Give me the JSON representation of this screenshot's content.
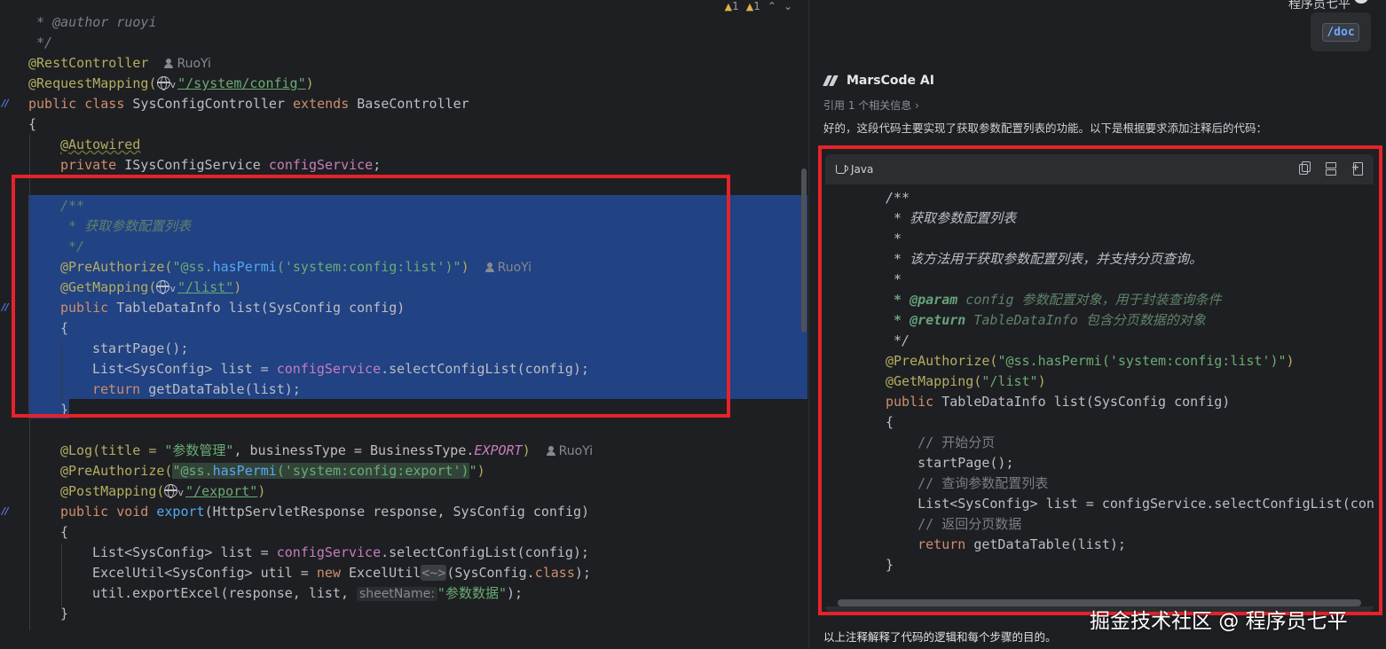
{
  "editor": {
    "inspections": {
      "warning_count": "1",
      "weak_warning_count": "1",
      "up_arrow": "⌃",
      "down_arrow": "⌄"
    },
    "author_hint": "RuoYi",
    "lines": {
      "l0": " * @author ruoyi",
      "l1": " */",
      "restcontroller": "@RestController",
      "requestmapping_pre": "@RequestMapping(",
      "requestmapping_url": "\"/system/config\"",
      "requestmapping_post": ")",
      "class_decl_kw1": "public class ",
      "class_name": "SysConfigController ",
      "class_kw2": "extends ",
      "class_base": "BaseController",
      "brace_open": "{",
      "autowired": "@Autowired",
      "field_kw": "private ",
      "field_type": "ISysConfigService ",
      "field_name": "configService",
      "field_end": ";",
      "doc_open": "/**",
      "doc_text": " * 获取参数配置列表",
      "doc_close": " */",
      "preauth_pre": "@PreAuthorize(",
      "preauth_str_a": "\"@ss.",
      "preauth_mth": "hasPermi",
      "preauth_str_list": "('system:config:list')\"",
      "preauth_post": ")",
      "getmapping_pre": "@GetMapping(",
      "getmapping_url": "\"/list\"",
      "getmapping_post": ")",
      "list_kw": "public ",
      "list_sig": "TableDataInfo list(SysConfig config)",
      "inner_brace_open": "{",
      "startpage": "startPage();",
      "list_decl_pre": "List<SysConfig> list = ",
      "list_decl_field": "configService",
      "list_decl_post": ".selectConfigList(config);",
      "return_kw": "return ",
      "return_rest": "getDataTable(list);",
      "inner_brace_close": "}",
      "log_pre": "@Log(title = ",
      "log_title": "\"参数管理\"",
      "log_mid": ", businessType = BusinessType.",
      "log_export": "EXPORT",
      "log_post": ")",
      "preauth2_str_export": "('system:config:export')",
      "preauth2_end": "\"",
      "postmapping_pre": "@PostMapping(",
      "postmapping_url": "\"/export\"",
      "export_kw": "public void ",
      "export_name": "export",
      "export_rest": "(HttpServletResponse response, SysConfig config)",
      "excel_pre": "ExcelUtil<SysConfig> util = ",
      "excel_new": "new ",
      "excel_cls": "ExcelUtil",
      "excel_diamond": "<~>",
      "excel_mid": "(SysConfig.",
      "excel_class_kw": "class",
      "excel_end": ");",
      "export_call_pre": "util.exportExcel(response, list, ",
      "inlay_sheetname": "sheetName:",
      "export_call_str": "\"参数数据\"",
      "export_call_end": ");",
      "close_method": "}"
    }
  },
  "chat": {
    "top_partial_text": "程序员七平",
    "doc_chip": "/doc",
    "assistant_name": "MarsCode AI",
    "reference_text": "引用 1 个相关信息 ›",
    "intro_text": "好的，这段代码主要实现了获取参数配置列表的功能。以下是根据要求添加注释后的代码：",
    "code_block": {
      "language": "Java",
      "actions": [
        "copy-icon",
        "insert-icon",
        "new-file-icon"
      ],
      "lines": {
        "c0": "/**",
        "c1": " * 获取参数配置列表",
        "c2": " *",
        "c3": " * 该方法用于获取参数配置列表，并支持分页查询。",
        "c4": " *",
        "c5_tag": " * @param",
        "c5_rest": " config 参数配置对象，用于封装查询条件",
        "c6_tag": " * @return",
        "c6_rest": " TableDataInfo 包含分页数据的对象",
        "c7": " */",
        "c8_pre": "@PreAuthorize(",
        "c8_str": "\"@ss.hasPermi('system:config:list')\"",
        "c8_post": ")",
        "c9_pre": "@GetMapping(",
        "c9_str": "\"/list\"",
        "c9_post": ")",
        "c10_kw": "public ",
        "c10_rest": "TableDataInfo list(SysConfig config)",
        "c11": "{",
        "c12": "    // 开始分页",
        "c13": "    startPage();",
        "c14": "    // 查询参数配置列表",
        "c15": "    List<SysConfig> list = configService.selectConfigList(con",
        "c16": "    // 返回分页数据",
        "c17_kw": "    return ",
        "c17_rest": "getDataTable(list);",
        "c18": "}"
      }
    },
    "outro_text": "以上注释解释了代码的逻辑和每个步骤的目的。"
  },
  "watermark": "掘金技术社区 @ 程序员七平",
  "colors": {
    "selection": "#214283",
    "highlight_box": "#e5232b",
    "background": "#1e1f22",
    "accent_blue": "#56a8f5"
  }
}
